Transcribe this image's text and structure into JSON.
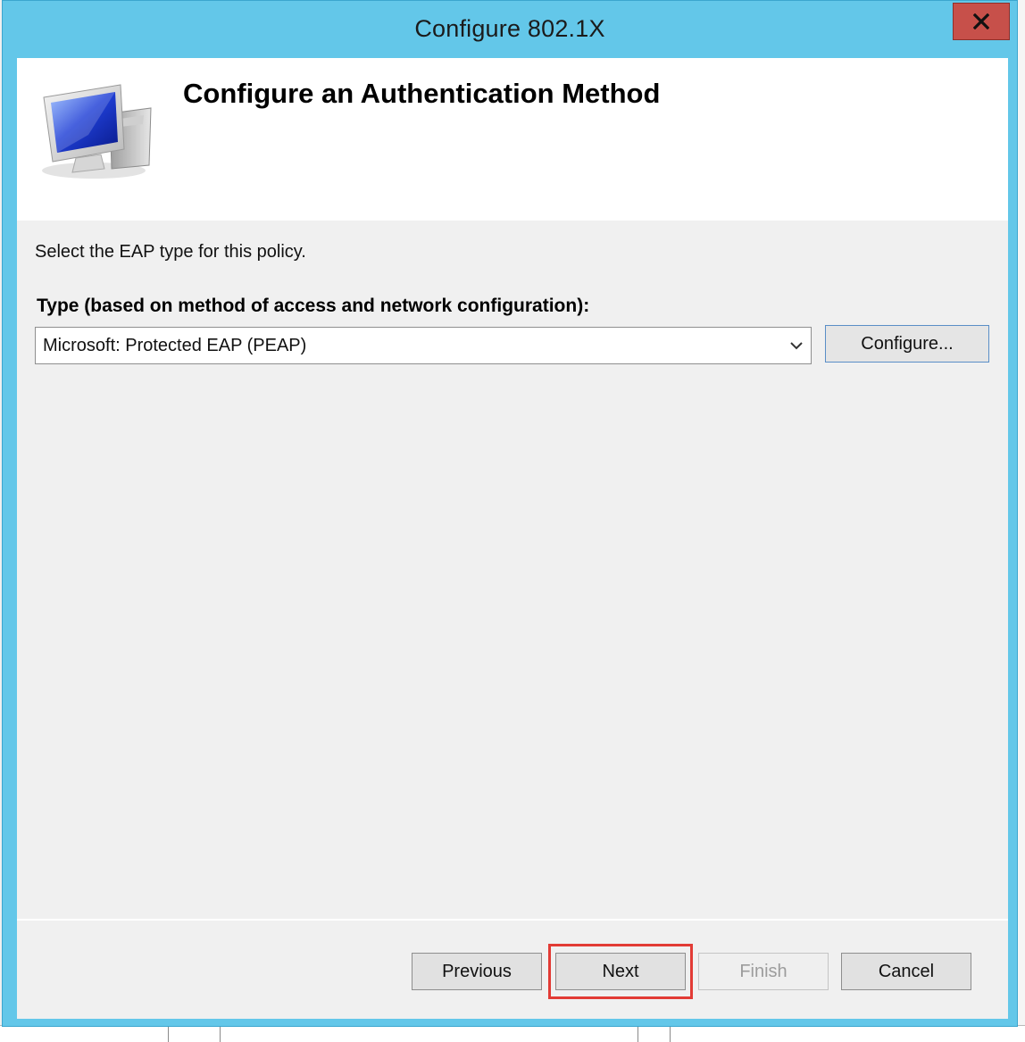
{
  "window": {
    "title": "Configure 802.1X",
    "close_label": "close"
  },
  "header": {
    "title": "Configure an Authentication Method",
    "icon": "computer-monitor-icon"
  },
  "body": {
    "instruction": "Select the EAP type for this policy.",
    "type_label": "Type (based on method of access and network configuration):",
    "type_select": {
      "value": "Microsoft: Protected EAP (PEAP)"
    },
    "configure_label": "Configure..."
  },
  "footer": {
    "previous_label": "Previous",
    "next_label": "Next",
    "finish_label": "Finish",
    "cancel_label": "Cancel",
    "highlight_color": "#e23b35"
  },
  "colors": {
    "titlebar": "#63c7e9",
    "close_button": "#c7504a"
  }
}
